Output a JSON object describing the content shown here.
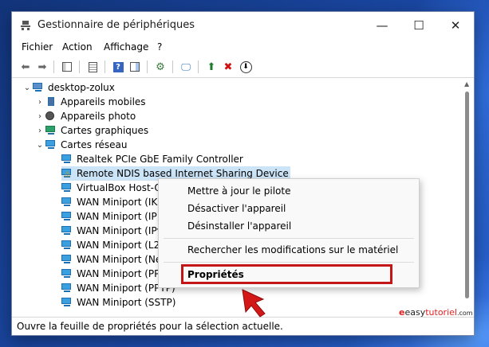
{
  "window": {
    "title": "Gestionnaire de périphériques"
  },
  "menu": [
    "Fichier",
    "Action",
    "Affichage",
    "?"
  ],
  "tree": {
    "root": "desktop-zolux",
    "categories": [
      "Appareils mobiles",
      "Appareils photo",
      "Cartes graphiques",
      "Cartes réseau"
    ],
    "devices": [
      "Realtek PCIe GbE Family Controller",
      "Remote NDIS based Internet Sharing Device",
      "VirtualBox Host-O",
      "WAN Miniport (IKE",
      "WAN Miniport (IP)",
      "WAN Miniport (IPv",
      "WAN Miniport (L2",
      "WAN Miniport (Ne",
      "WAN Miniport (PP",
      "WAN Miniport (PPTP)",
      "WAN Miniport (SSTP)"
    ]
  },
  "context_menu": {
    "items": [
      "Mettre à jour le pilote",
      "Désactiver l'appareil",
      "Désinstaller l'appareil",
      "Rechercher les modifications sur le matériel",
      "Propriétés"
    ]
  },
  "status": "Ouvre la feuille de propriétés pour la sélection actuelle.",
  "watermark": {
    "brand_a": "easy",
    "brand_b": "tutoriel",
    "tld": ".com"
  },
  "colors": {
    "highlight": "#c41616",
    "selection": "#cce4f7"
  }
}
